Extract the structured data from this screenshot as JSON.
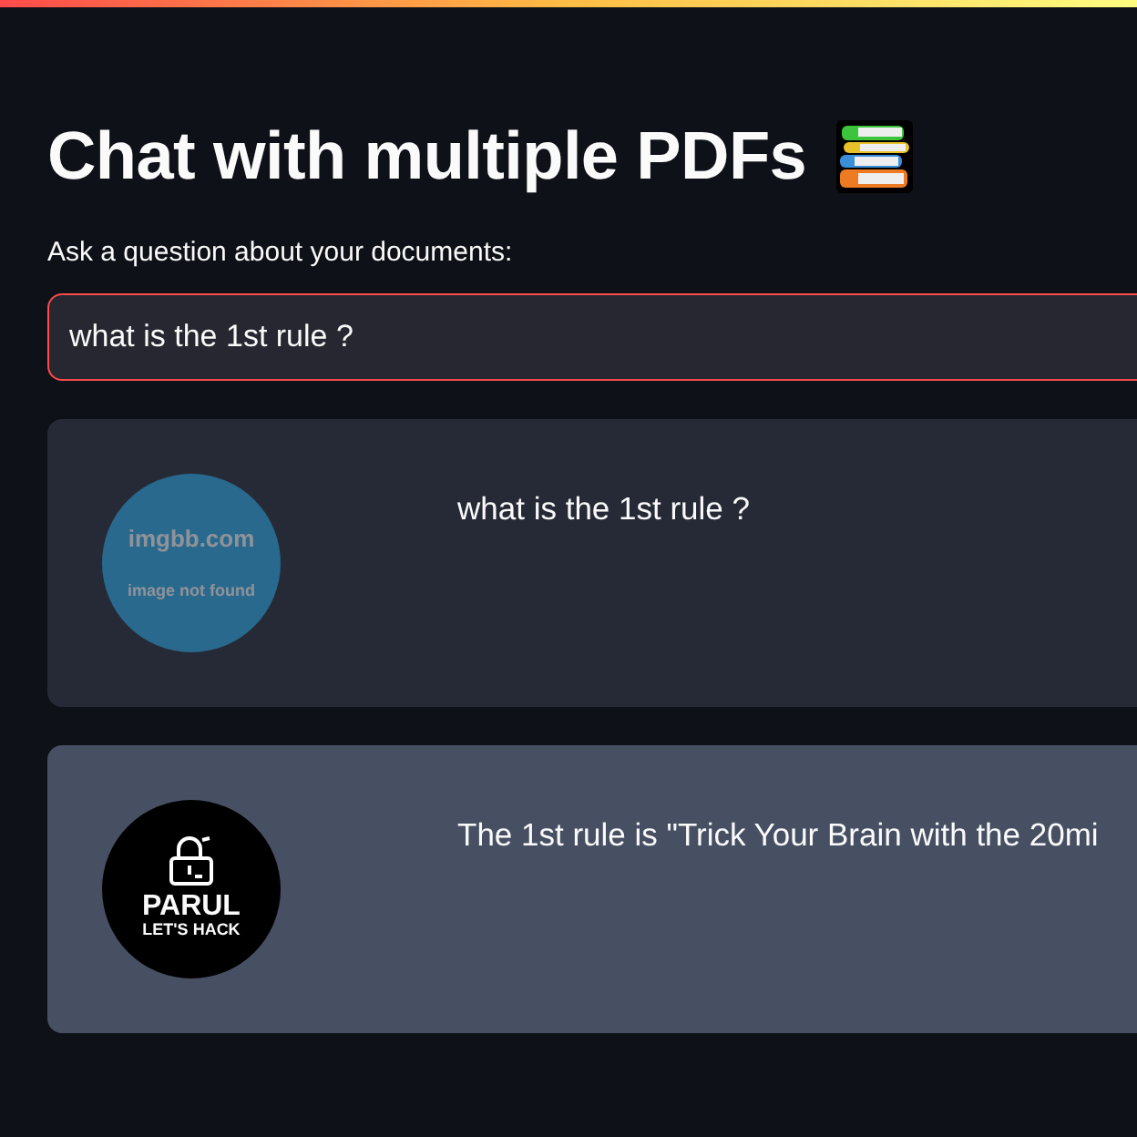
{
  "title": "Chat with multiple PDFs",
  "question": {
    "label": "Ask a question about your documents:",
    "value": "what is the 1st rule ?",
    "focused": true
  },
  "messages": [
    {
      "kind": "user",
      "text": "what is the 1st rule ?",
      "avatar": {
        "kind": "placeholder",
        "line_1": "imgbb.com",
        "line_2": "image not found"
      }
    },
    {
      "kind": "bot",
      "text": "The 1st rule is \"Trick Your Brain with the 20mi",
      "avatar": {
        "kind": "logo",
        "line_1": "PARUL",
        "line_2": "LET'S HACK"
      }
    }
  ]
}
